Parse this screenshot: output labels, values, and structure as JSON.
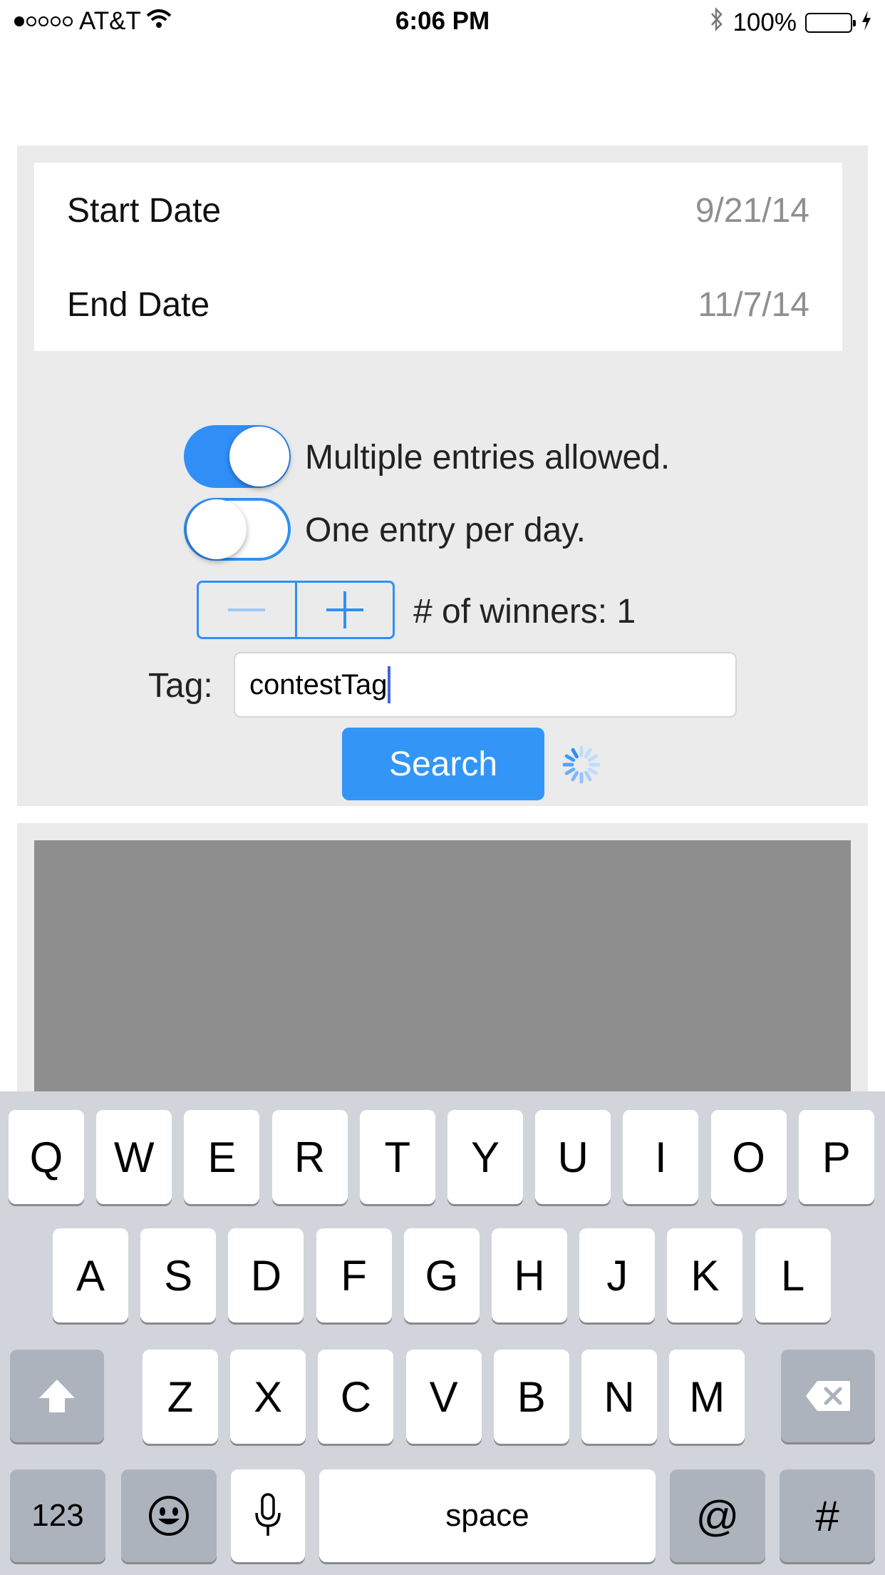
{
  "status_bar": {
    "carrier": "AT&T",
    "time": "6:06 PM",
    "battery": "100%",
    "signal_bars_filled": 1,
    "signal_bars_total": 5
  },
  "dates": {
    "start_label": "Start Date",
    "start_value": "9/21/14",
    "end_label": "End Date",
    "end_value": "11/7/14"
  },
  "options": {
    "multiple_entries_label": "Multiple entries allowed.",
    "multiple_entries_on": true,
    "one_per_day_label": "One entry per day.",
    "one_per_day_on": false
  },
  "winners": {
    "label": "# of winners: 1",
    "decrement_icon": "minus-icon",
    "increment_icon": "plus-icon"
  },
  "tag": {
    "label": "Tag:",
    "value": "contestTag"
  },
  "search": {
    "button_label": "Search",
    "loading_icon": "spinner-icon"
  },
  "colors": {
    "accent": "#2f8ff7",
    "results_area": "#8e8e8e",
    "panel_bg": "#ebebeb"
  },
  "keyboard": {
    "row1": [
      "Q",
      "W",
      "E",
      "R",
      "T",
      "Y",
      "U",
      "I",
      "O",
      "P"
    ],
    "row2": [
      "A",
      "S",
      "D",
      "F",
      "G",
      "H",
      "J",
      "K",
      "L"
    ],
    "row3": [
      "Z",
      "X",
      "C",
      "V",
      "B",
      "N",
      "M"
    ],
    "numbers_key": "123",
    "space_key": "space",
    "at_key": "@",
    "hash_key": "#",
    "shift_icon": "shift-icon",
    "delete_icon": "delete-icon",
    "emoji_icon": "emoji-icon",
    "mic_icon": "microphone-icon"
  }
}
